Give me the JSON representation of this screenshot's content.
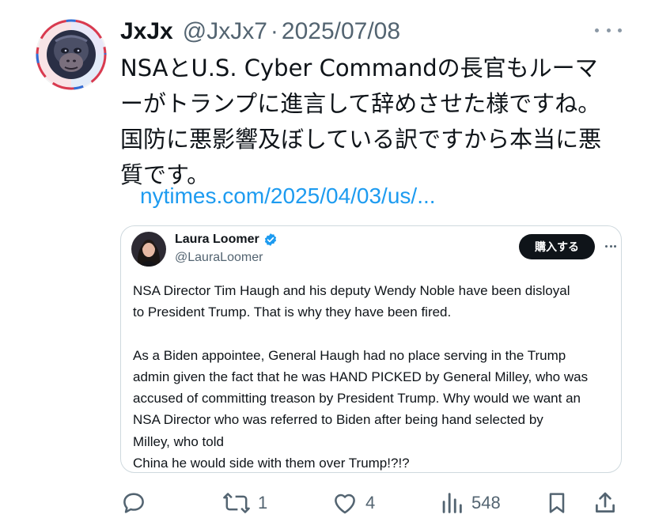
{
  "tweet": {
    "display_name": "JxJx",
    "handle": "@JxJx7",
    "separator": "·",
    "date": "2025/07/08",
    "text_lines": [
      "NSAとU.S. Cyber Commandの長官もルーマ",
      "ーがトランプに進言して辞めさせた様ですね。",
      "国防に悪影響及ぼしている訳ですから本当に悪",
      "質です。"
    ],
    "link": "nytimes.com/2025/04/03/us/..."
  },
  "quote": {
    "display_name": "Laura Loomer",
    "handle": "@LauraLoomer",
    "buy_button": "購入する",
    "lines": [
      "NSA Director Tim Haugh and his deputy Wendy Noble have been disloyal",
      "to President Trump. That is why they have been fired.",
      "",
      "As a Biden appointee, General Haugh had no place serving in the Trump",
      "admin given the fact that he was HAND PICKED by General Milley, who was",
      "accused of committing treason by President Trump. Why would we want an",
      "NSA Director who was referred to Biden after being hand selected by",
      "Milley, who told",
      "China he would side with them over Trump!?!?"
    ]
  },
  "actions": {
    "replies": "",
    "reposts": "1",
    "likes": "4",
    "views": "548"
  },
  "icons": {
    "avatar": "ape-logo-avatar",
    "verified": "verified-badge-icon",
    "reply": "reply-icon",
    "repost": "repost-icon",
    "like": "heart-icon",
    "views": "views-chart-icon",
    "bookmark": "bookmark-icon",
    "share": "share-icon"
  },
  "colors": {
    "text": "#0f1419",
    "secondary": "#536471",
    "link": "#1d9bf0",
    "border": "#cfd9de",
    "verified": "#1d9bf0"
  }
}
